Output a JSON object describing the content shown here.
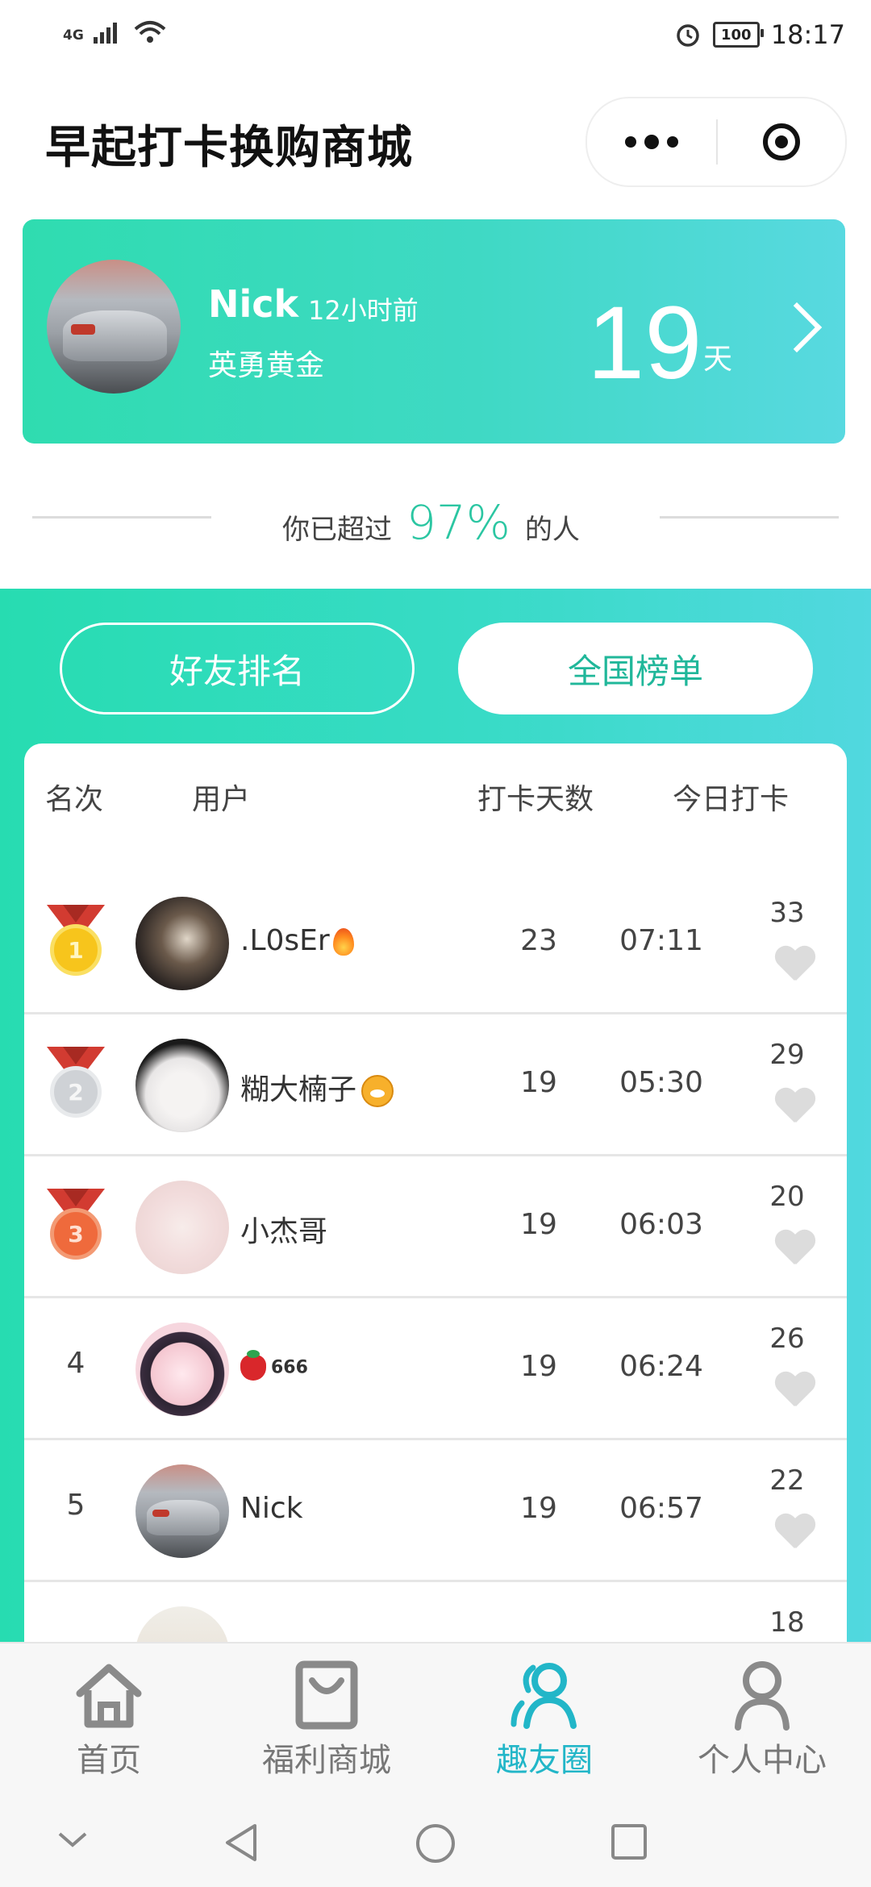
{
  "status_bar": {
    "network": "4G",
    "battery": "100",
    "time": "18:17"
  },
  "header": {
    "title": "早起打卡换购商城"
  },
  "profile": {
    "name": "Nick",
    "time_ago": "12小时前",
    "rank_title": "英勇黄金",
    "days": "19",
    "days_unit": "天"
  },
  "percent": {
    "prefix": "你已超过",
    "value": "97%",
    "suffix": "的人"
  },
  "tabs": {
    "friends": "好友排名",
    "national": "全国榜单",
    "active": "national"
  },
  "table": {
    "headers": [
      "名次",
      "用户",
      "打卡天数",
      "今日打卡"
    ],
    "rows": [
      {
        "rank": "1",
        "user": ".L0sEr",
        "days": "23",
        "time": "07:11",
        "likes": "33"
      },
      {
        "rank": "2",
        "user": "糊大楠子",
        "days": "19",
        "time": "05:30",
        "likes": "29"
      },
      {
        "rank": "3",
        "user": "小杰哥",
        "days": "19",
        "time": "06:03",
        "likes": "20"
      },
      {
        "rank": "4",
        "user": "666",
        "days": "19",
        "time": "06:24",
        "likes": "26"
      },
      {
        "rank": "5",
        "user": "Nick",
        "days": "19",
        "time": "06:57",
        "likes": "22"
      },
      {
        "rank": "",
        "user": "",
        "days": "",
        "time": "",
        "likes": "18"
      }
    ]
  },
  "bottom_nav": {
    "items": [
      {
        "label": "首页",
        "icon": "home-icon"
      },
      {
        "label": "福利商城",
        "icon": "shopping-bag-icon"
      },
      {
        "label": "趣友圈",
        "icon": "friends-icon"
      },
      {
        "label": "个人中心",
        "icon": "profile-icon"
      }
    ],
    "active_index": 2
  },
  "colors": {
    "accent": "#2bc6a2",
    "active_tab": "#22b6c8",
    "gradient_start": "#27dcb1",
    "gradient_end": "#51d8df"
  }
}
